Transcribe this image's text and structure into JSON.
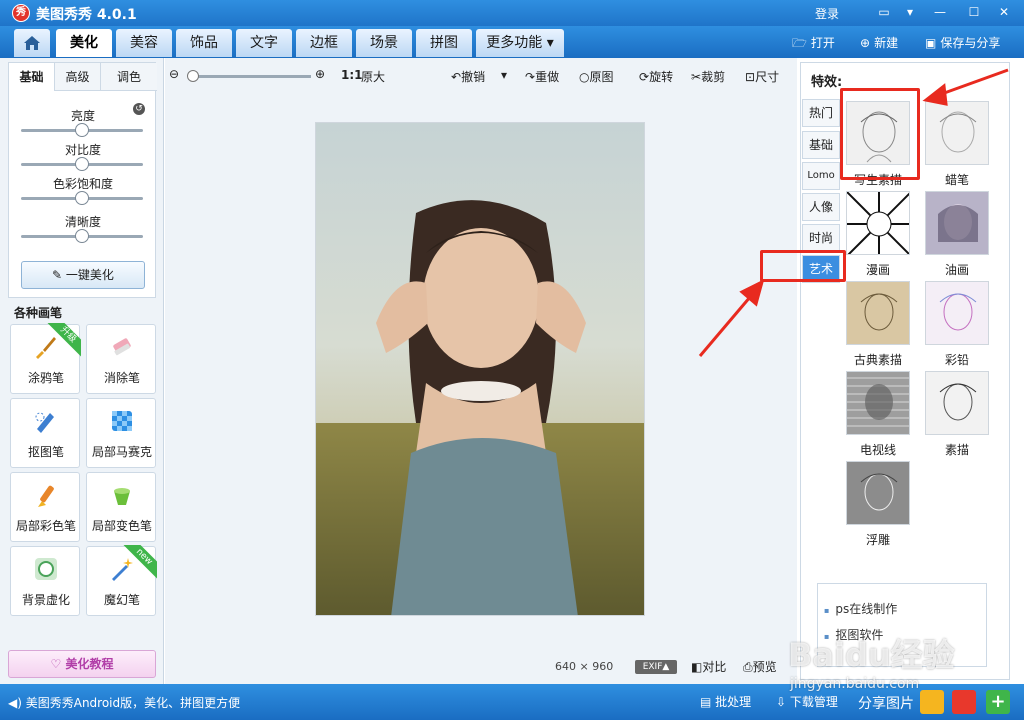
{
  "app": {
    "logo_text": "秀",
    "title": "美图秀秀 4.0.1",
    "login": "登录"
  },
  "window_controls": [
    "chat-icon",
    "menu-icon",
    "minimize-icon",
    "maximize-icon",
    "close-icon"
  ],
  "tabs": [
    {
      "label": "美化",
      "active": true
    },
    {
      "label": "美容"
    },
    {
      "label": "饰品"
    },
    {
      "label": "文字"
    },
    {
      "label": "边框"
    },
    {
      "label": "场景"
    },
    {
      "label": "拼图"
    },
    {
      "label": "更多功能 ▾"
    }
  ],
  "top_actions": {
    "open": "打开",
    "new": "新建",
    "save": "保存与分享"
  },
  "left": {
    "subtabs": [
      "基础",
      "高级",
      "调色"
    ],
    "sliders": [
      {
        "label": "亮度",
        "value": 0.5
      },
      {
        "label": "对比度",
        "value": 0.5
      },
      {
        "label": "色彩饱和度",
        "value": 0.5
      },
      {
        "label": "清晰度",
        "value": 0.5
      }
    ],
    "onekey": "一键美化",
    "section_title": "各种画笔",
    "brushes": [
      {
        "label": "涂鸦笔",
        "ribbon": "升级"
      },
      {
        "label": "消除笔"
      },
      {
        "label": "抠图笔"
      },
      {
        "label": "局部马赛克"
      },
      {
        "label": "局部彩色笔"
      },
      {
        "label": "局部变色笔"
      },
      {
        "label": "背景虚化"
      },
      {
        "label": "魔幻笔",
        "ribbon": "new"
      }
    ],
    "tutorial": "美化教程"
  },
  "toolbar": {
    "ratio": "1:1",
    "original_size": "原大",
    "undo": "撤销",
    "redo": "重做",
    "original": "原图",
    "rotate": "旋转",
    "crop": "裁剪",
    "size": "尺寸"
  },
  "canvas": {
    "dimensions": "640 × 960",
    "exif": "EXIF▲",
    "compare": "对比",
    "preview": "预览"
  },
  "effects": {
    "title": "特效:",
    "categories": [
      {
        "label": "热门"
      },
      {
        "label": "基础"
      },
      {
        "label": "Lomo"
      },
      {
        "label": "人像"
      },
      {
        "label": "时尚"
      },
      {
        "label": "艺术",
        "active": true
      }
    ],
    "items": [
      {
        "label": "写生素描"
      },
      {
        "label": "蜡笔"
      },
      {
        "label": "漫画"
      },
      {
        "label": "油画"
      },
      {
        "label": "古典素描"
      },
      {
        "label": "彩铅"
      },
      {
        "label": "电视线"
      },
      {
        "label": "素描"
      },
      {
        "label": "浮雕"
      }
    ],
    "ads": [
      "ps在线制作",
      "抠图软件"
    ]
  },
  "statusbar": {
    "text": "美图秀秀Android版，美化、拼图更方便",
    "batch": "批处理",
    "download": "下载管理",
    "share": "分享图片"
  },
  "watermark": {
    "main": "Baidu经验",
    "sub": "jingyan.baidu.com"
  },
  "colors": {
    "titlebar": "#1f74c9",
    "highlight": "#e82a1f",
    "active_category": "#3b8ee0"
  }
}
